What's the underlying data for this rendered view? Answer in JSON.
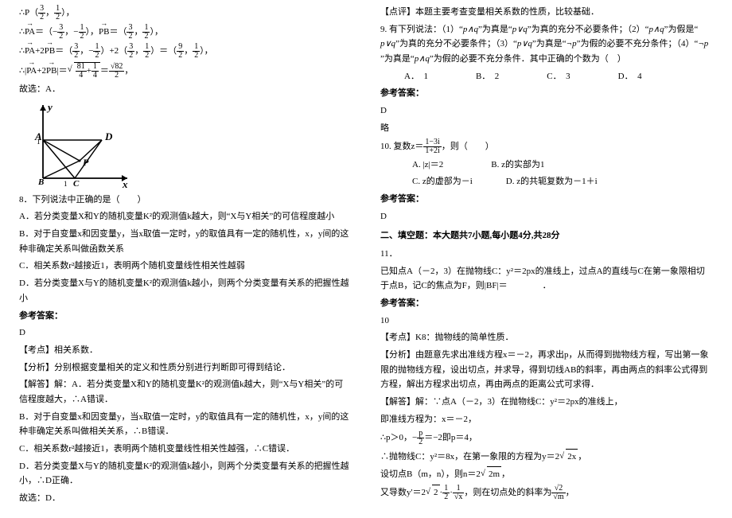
{
  "left": {
    "p_coord": "∴P（3/2，1/2），",
    "vectors": "∴PA＝（−3/2，−1/2），PB＝（3/2，1/2），",
    "sum": "∴PA+2PB＝（3/2，−1/2）+2（3/2，1/2）＝（9/2，1/2），",
    "mag": "∴|PA+2PB|＝√(81/4+1/4)＝√82/2，",
    "ans_sel": "故选：A．",
    "graph_labels": {
      "A": "A",
      "B": "B",
      "C": "C",
      "D": "D",
      "P": "P",
      "x": "x",
      "y": "y",
      "one": "1",
      "oneright": "1"
    },
    "q8": "8．下列说法中正确的是（　　）",
    "q8A": "A．若分类变量X和Y的随机变量K²的观测值k越大，则“X与Y相关”的可信程度越小",
    "q8B": "B．对于自变量x和因变量y，当x取值一定时，y的取值具有一定的随机性，x，y间的这种非确定关系叫做函数关系",
    "q8C": "C．相关系数r²越接近1，表明两个随机变量线性相关性越弱",
    "q8D": "D．若分类变量X与Y的随机变量K²的观测值k越小，则两个分类变量有关系的把握性越小",
    "q8_ans_label": "参考答案：",
    "q8_ans": "D",
    "q8_kaodian": "【考点】相关系数．",
    "q8_fenxi": "【分析】分别根据变量相关的定义和性质分别进行判断即可得到结论．",
    "q8_jieda_hdr": "【解答】解：A．若分类变量X和Y的随机变量K²的观测值k越大，则“X与Y相关”的可信程度越大，∴A错误．",
    "q8_jieda_b": "B．对于自变量x和因变量y，当x取值一定时，y的取值具有一定的随机性，x，y间的这种非确定关系叫做相关关系，∴B错误．",
    "q8_jieda_c": "C．相关系数r²越接近1，表明两个随机变量线性相关性越强，∴C错误．",
    "q8_jieda_d": "D．若分类变量X与Y的随机变量K²的观测值k越小，则两个分类变量有关系的把握性越小，∴D正确．",
    "q8_final": "故选：D．"
  },
  "right": {
    "dianping": "【点评】本题主要考查变量相关系数的性质，比较基础．",
    "q9": "9. 有下列说法：（1）“p∧q”为真是“p∨q”为真的充分不必要条件；（2）“p∧q”为假是“p∨q”为真的充分不必要条件；（3）“p∨q”为真是“¬p”为假的必要不充分条件；（4）“¬p”为真是“p∧q”为假的必要不充分条件．其中正确的个数为（　）",
    "q9_opts": {
      "A": "A．　1",
      "B": "B．　2",
      "C": "C．　3",
      "D": "D．　4"
    },
    "q9_ans_label": "参考答案：",
    "q9_ans": "D",
    "q9_ans2": "略",
    "q10": "10. 复数z＝(1−3i)/(1+2i)，则（　　）",
    "q10_opts": {
      "A": "A. |z|＝2",
      "B": "B. z的实部为1",
      "C": "C. z的虚部为－i",
      "D": "D. z的共轭复数为－1＋i"
    },
    "q10_ans_label": "参考答案：",
    "q10_ans": "D",
    "sec2": "二、填空题：本大题共7小题,每小题4分,共28分",
    "q11": "11．",
    "q11_body": "已知点A（－2，3）在抛物线C：y²＝2px的准线上，过点A的直线与C在第一象限相切于点B，记C的焦点为F，则|BF|＝　　　　．",
    "q11_ans_label": "参考答案：",
    "q11_ans": "10",
    "q11_kaodian": "【考点】K8：抛物线的简单性质．",
    "q11_fenxi": "【分析】由题意先求出准线方程x＝－2，再求出p，从而得到抛物线方程，写出第一象限的抛物线方程，设出切点，并求导，得到切线AB的斜率，再由两点的斜率公式得到方程，解出方程求出切点，再由两点的距离公式可求得．",
    "q11_jieda1": "【解答】解：∵点A（－2，3）在抛物线C：y²＝2px的准线上，",
    "q11_jieda2": "即准线方程为：x＝－2，",
    "q11_jieda3": "∴p＞0，−p/2＝－2即p＝4，",
    "q11_jieda4": "∴抛物线C：y²＝8x，在第一象限的方程为y＝2√(2x)，",
    "q11_jieda5": "设切点B（m，n），则n＝2√(2m)，",
    "q11_jieda6": "又导数y'＝2√2·(1/2)·(1/√x)，则在切点处的斜率为√2/√m，"
  }
}
